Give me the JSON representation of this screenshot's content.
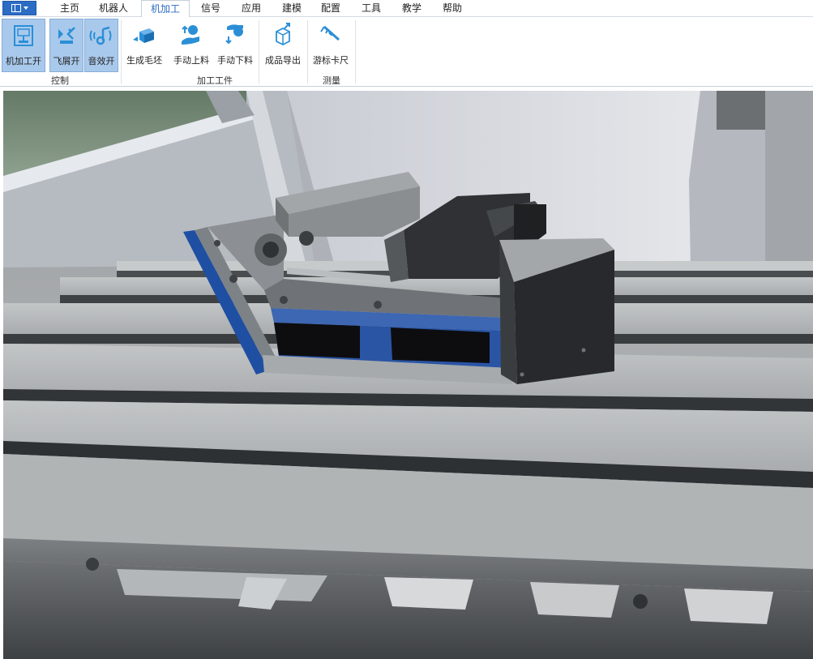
{
  "menu": {
    "tabs": [
      "主页",
      "机器人",
      "机加工",
      "信号",
      "应用",
      "建模",
      "配置",
      "工具",
      "教学",
      "帮助"
    ],
    "active_tab": "机加工"
  },
  "ribbon": {
    "groups": {
      "control": "控制",
      "workpiece": "加工工件",
      "measure": "测量"
    },
    "buttons": {
      "machining_on": "机加工开",
      "chips_on": "飞屑开",
      "sound_on": "音效开",
      "gen_blank": "生成毛坯",
      "manual_load": "手动上料",
      "manual_unload": "手动下料",
      "export_product": "成品导出",
      "caliper": "游标卡尺"
    },
    "accent_color": "#2b8fd6",
    "active_button_color": "#a9c9ec"
  }
}
